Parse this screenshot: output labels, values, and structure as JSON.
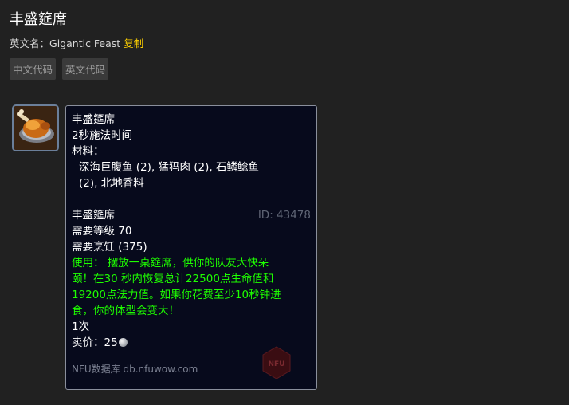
{
  "page": {
    "title": "丰盛筵席",
    "en_name_label": "英文名：",
    "en_name_value": "Gigantic Feast",
    "copy_label": "复制",
    "code_buttons": [
      "中文代码",
      "英文代码"
    ]
  },
  "item": {
    "icon": "roast-turkey-icon",
    "tooltip": {
      "spell_name": "丰盛筵席",
      "cast_time": "2秒施法时间",
      "reagents_label": "材料：",
      "reagents_line1": "深海巨腹鱼 (2), 猛犸肉 (2), 石鳞鲶鱼",
      "reagents_line2": "(2), 北地香料",
      "item_name": "丰盛筵席",
      "id_text": "ID: 43478",
      "req_level": "需要等级 70",
      "req_skill": "需要烹饪 (375)",
      "use_lines": [
        "使用：  摆放一桌筵席，供你的队友大快朵",
        "颐！在30 秒内恢复总计22500点生命值和",
        "19200点法力值。如果你花费至少10秒钟进",
        "食，你的体型会变大！"
      ],
      "charges": "1次",
      "sell_label": "卖价：",
      "sell_value": "25",
      "footer": "NFU数据库 db.nfuwow.com",
      "logo_text": "NFU"
    }
  },
  "colors": {
    "page_bg": "#212121",
    "tooltip_bg": "#070a1c",
    "use_text": "#1eff00",
    "copy_link": "#ffd100",
    "id_text": "#5f6575"
  }
}
